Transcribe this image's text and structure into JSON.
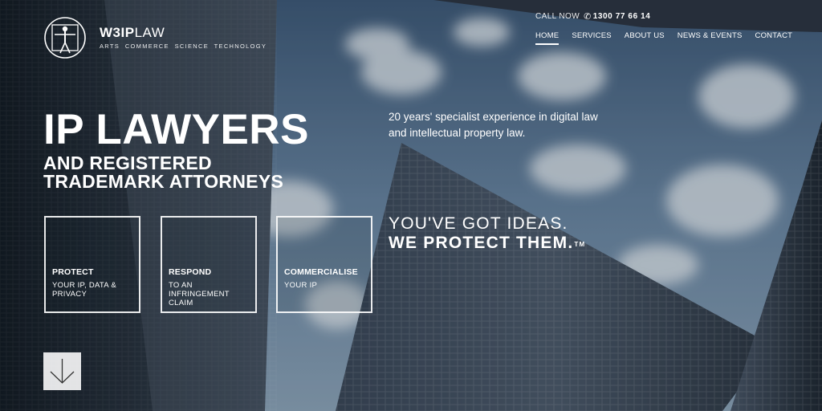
{
  "brand": {
    "name_bold": "W3IP",
    "name_light": "LAW",
    "tagline": "ARTS  COMMERCE  SCIENCE  TECHNOLOGY"
  },
  "contact": {
    "call_label": "CALL NOW",
    "phone_icon": "phone-icon",
    "phone": "1300 77 66 14"
  },
  "nav": {
    "items": [
      {
        "label": "HOME",
        "active": true
      },
      {
        "label": "SERVICES"
      },
      {
        "label": "ABOUT US"
      },
      {
        "label": "NEWS & EVENTS"
      },
      {
        "label": "CONTACT"
      }
    ]
  },
  "hero": {
    "title": "IP LAWYERS",
    "subtitle_line1": "AND REGISTERED",
    "subtitle_line2": "TRADEMARK ATTORNEYS",
    "intro_line1": "20 years' specialist experience in digital law",
    "intro_line2": "and intellectual property law.",
    "slogan_line1": "YOU'VE GOT IDEAS.",
    "slogan_line2": "WE PROTECT THEM.",
    "slogan_mark": "TM"
  },
  "cards": [
    {
      "title": "PROTECT",
      "line1": "YOUR IP, DATA &",
      "line2": "PRIVACY"
    },
    {
      "title": "RESPOND",
      "line1": "TO AN",
      "line2": "INFRINGEMENT",
      "line3": "CLAIM"
    },
    {
      "title": "COMMERCIALISE",
      "line1": "YOUR IP"
    }
  ],
  "icons": {
    "logo": "vitruvian-man-logo-icon",
    "scroll": "arrow-down-icon"
  },
  "colors": {
    "sky": "#55708c",
    "cloud": "#d9e1e8",
    "building_dark": "#1c2530",
    "text": "#ffffff"
  }
}
